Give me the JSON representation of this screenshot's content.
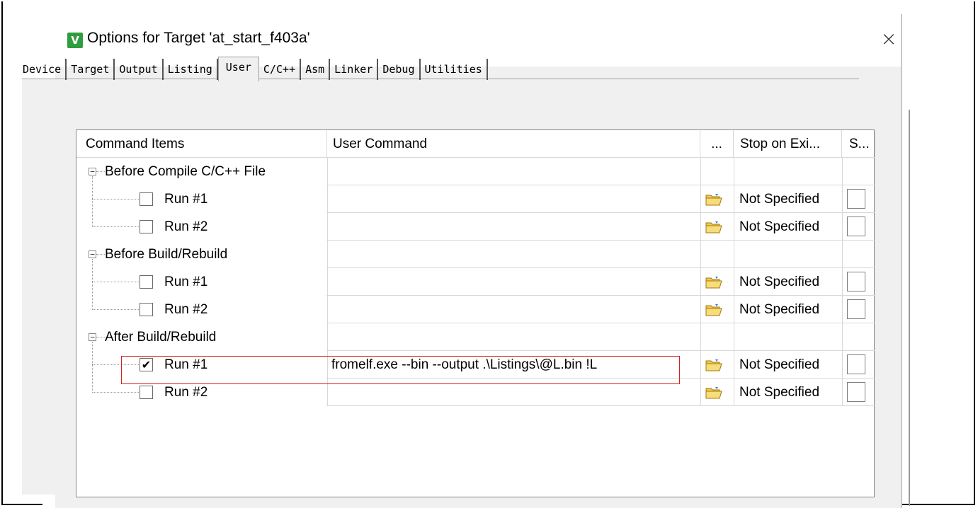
{
  "top_crop_text": "",
  "dialog": {
    "title": "Options for Target 'at_start_f403a'",
    "close_label": "×",
    "app_icon_glyph": "V"
  },
  "tabs": [
    {
      "label": "Device",
      "active": false
    },
    {
      "label": "Target",
      "active": false
    },
    {
      "label": "Output",
      "active": false
    },
    {
      "label": "Listing",
      "active": false
    },
    {
      "label": "User",
      "active": true
    },
    {
      "label": "C/C++",
      "active": false
    },
    {
      "label": "Asm",
      "active": false
    },
    {
      "label": "Linker",
      "active": false
    },
    {
      "label": "Debug",
      "active": false
    },
    {
      "label": "Utilities",
      "active": false
    }
  ],
  "grid": {
    "headers": {
      "command_items": "Command Items",
      "user_command": "User Command",
      "browse": "...",
      "stop_on_exit": "Stop on Exi...",
      "s_col": "S..."
    },
    "groups": [
      {
        "label": "Before Compile C/C++ File",
        "expander": "−",
        "runs": [
          {
            "label": "Run #1",
            "checked": false,
            "command": "",
            "stop": "Not Specified"
          },
          {
            "label": "Run #2",
            "checked": false,
            "command": "",
            "stop": "Not Specified"
          }
        ]
      },
      {
        "label": "Before Build/Rebuild",
        "expander": "−",
        "runs": [
          {
            "label": "Run #1",
            "checked": false,
            "command": "",
            "stop": "Not Specified"
          },
          {
            "label": "Run #2",
            "checked": false,
            "command": "",
            "stop": "Not Specified"
          }
        ]
      },
      {
        "label": "After Build/Rebuild",
        "expander": "−",
        "runs": [
          {
            "label": "Run #1",
            "checked": true,
            "command": "fromelf.exe --bin --output .\\Listings\\@L.bin !L",
            "stop": "Not Specified"
          },
          {
            "label": "Run #2",
            "checked": false,
            "command": "",
            "stop": "Not Specified"
          }
        ]
      }
    ]
  },
  "colors": {
    "highlight": "#d42020",
    "panel_bg": "#f0f0f0",
    "icon_green": "#2e9e3f"
  }
}
